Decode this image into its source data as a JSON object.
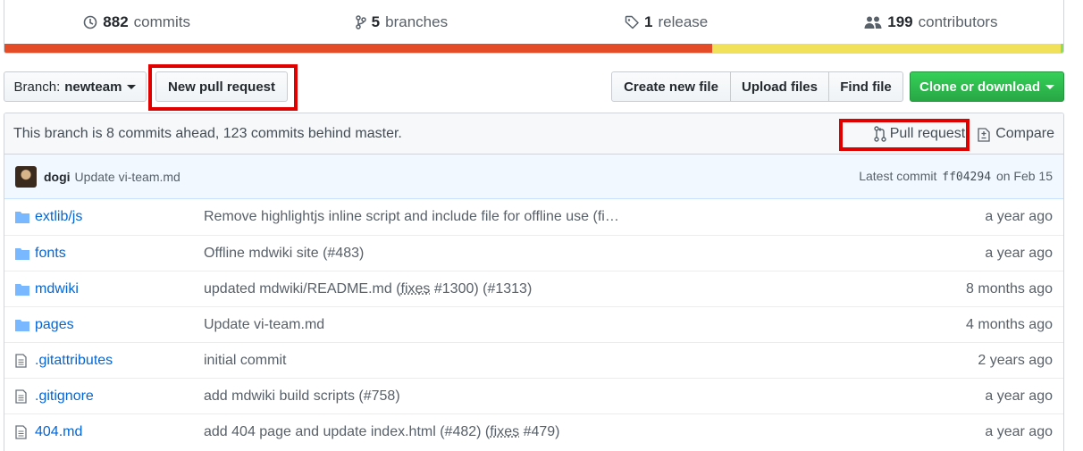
{
  "summary": {
    "commits": {
      "count": "882",
      "label": "commits"
    },
    "branches": {
      "count": "5",
      "label": "branches"
    },
    "releases": {
      "count": "1",
      "label": "release"
    },
    "contributors": {
      "count": "199",
      "label": "contributors"
    }
  },
  "toolbar": {
    "branch_prefix": "Branch:",
    "branch_name": "newteam",
    "new_pr_label": "New pull request",
    "create_file_label": "Create new file",
    "upload_label": "Upload files",
    "find_label": "Find file",
    "clone_label": "Clone or download"
  },
  "branch_info": {
    "text": "This branch is 8 commits ahead, 123 commits behind master.",
    "pull_request_label": "Pull request",
    "compare_label": "Compare"
  },
  "latest_commit": {
    "author": "dogi",
    "message": "Update vi-team.md",
    "prefix": "Latest commit",
    "sha": "ff04294",
    "date": "on Feb 15"
  },
  "files": [
    {
      "type": "dir",
      "name": "extlib/js",
      "message": "Remove highlightjs inline script and include file for offline use (fi…",
      "age": "a year ago"
    },
    {
      "type": "dir",
      "name": "fonts",
      "message": "Offline mdwiki site (#483)",
      "age": "a year ago"
    },
    {
      "type": "dir",
      "name": "mdwiki",
      "message_parts": [
        "updated mdwiki/README.md (",
        "fixes",
        " #1300) (#1313)"
      ],
      "age": "8 months ago"
    },
    {
      "type": "dir",
      "name": "pages",
      "message": "Update vi-team.md",
      "age": "4 months ago"
    },
    {
      "type": "file",
      "name": ".gitattributes",
      "message": "initial commit",
      "age": "2 years ago"
    },
    {
      "type": "file",
      "name": ".gitignore",
      "message": "add mdwiki build scripts (#758)",
      "age": "a year ago"
    },
    {
      "type": "file",
      "name": "404.md",
      "message_parts": [
        "add 404 page and update index.html (#482) (",
        "fixes",
        " #479)"
      ],
      "age": "a year ago"
    }
  ],
  "colors": {
    "accent": "#0366d6",
    "highlight": "#e00000",
    "clone_green": "#28a745",
    "lang_html": "#e34c26",
    "lang_js": "#f1e05a"
  },
  "icons": {
    "commits": "history-icon",
    "branches": "git-branch-icon",
    "releases": "tag-icon",
    "contributors": "people-icon"
  }
}
